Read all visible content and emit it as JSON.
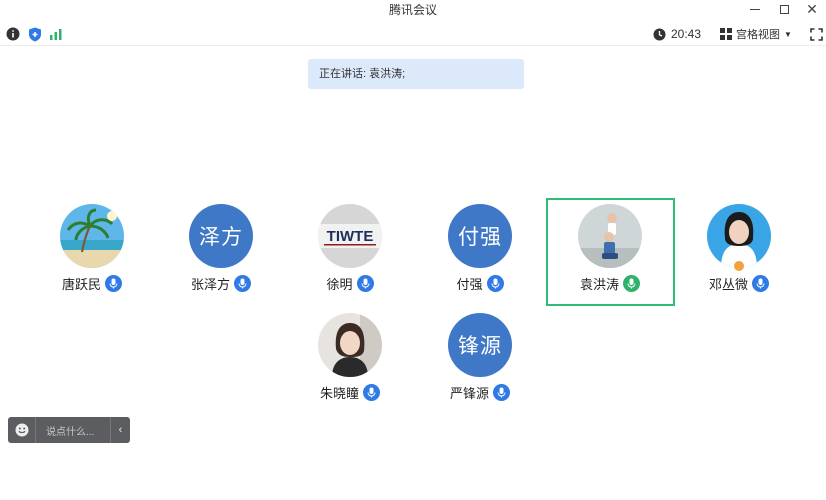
{
  "window": {
    "title": "腾讯会议"
  },
  "toolbar": {
    "time": "20:43",
    "view_label": "宫格视图"
  },
  "speaking_banner": "正在讲话: 袁洪涛;",
  "participants": [
    {
      "name": "唐跃民",
      "avatar": "beach-photo",
      "mic": "blue"
    },
    {
      "name": "张泽方",
      "avatar_text": "泽方",
      "mic": "blue"
    },
    {
      "name": "徐明",
      "avatar": "logo-photo",
      "mic": "blue"
    },
    {
      "name": "付强",
      "avatar_text": "付强",
      "mic": "blue"
    },
    {
      "name": "袁洪涛",
      "avatar": "child-photo",
      "mic": "green",
      "speaking": true
    },
    {
      "name": "邓丛微",
      "avatar": "portrait-photo",
      "mic": "blue",
      "host": true
    },
    {
      "name": "朱晓瞳",
      "avatar": "woman-photo",
      "mic": "blue"
    },
    {
      "name": "严锋源",
      "avatar_text": "锋源",
      "mic": "blue"
    }
  ],
  "chat": {
    "placeholder": "说点什么..."
  },
  "colors": {
    "accent": "#2f7ae5",
    "avatar_bg": "#3e78c6",
    "speaking_border": "#2dbd73",
    "banner_bg": "#dbe9fb"
  }
}
